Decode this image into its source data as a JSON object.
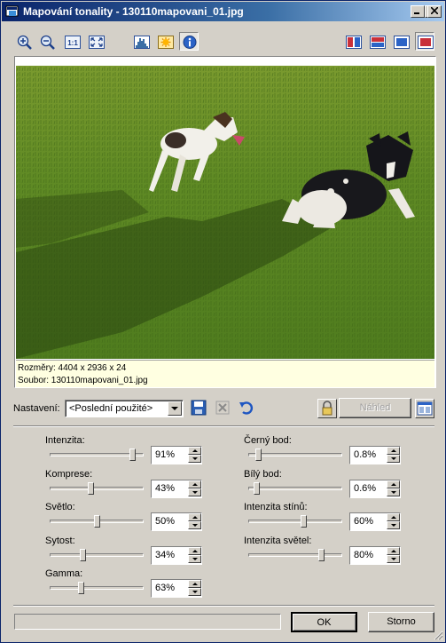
{
  "window": {
    "title": "Mapování tonality - 130110mapovani_01.jpg"
  },
  "toolbar": {
    "left_icons": [
      "zoom-in-icon",
      "zoom-out-icon",
      "actual-size-icon",
      "fit-window-icon",
      "histogram-icon",
      "lighting-icon",
      "info-icon"
    ],
    "right_icons": [
      "split-vertical-icon",
      "split-horizontal-icon",
      "single-view-icon",
      "original-view-icon"
    ]
  },
  "preview": {
    "dimensions": "Rozměry: 4404 x 2936 x 24",
    "file": "Soubor: 130110mapovani_01.jpg"
  },
  "settings": {
    "label": "Nastavení:",
    "selected": "<Poslední použité>",
    "preview_button": "Náhled"
  },
  "sliders_left": [
    {
      "label": "Intenzita:",
      "value": "91%",
      "level": 0.91
    },
    {
      "label": "Komprese:",
      "value": "43%",
      "level": 0.43
    },
    {
      "label": "Světlo:",
      "value": "50%",
      "level": 0.5
    },
    {
      "label": "Sytost:",
      "value": "34%",
      "level": 0.34
    },
    {
      "label": "Gamma:",
      "value": "63%",
      "level": 0.32
    }
  ],
  "sliders_right": [
    {
      "label": "Černý bod:",
      "value": "0.8%",
      "level": 0.08
    },
    {
      "label": "Bílý bod:",
      "value": "0.6%",
      "level": 0.06
    },
    {
      "label": "Intenzita stínů:",
      "value": "60%",
      "level": 0.6
    },
    {
      "label": "Intenzita světel:",
      "value": "80%",
      "level": 0.8
    }
  ],
  "buttons": {
    "ok": "OK",
    "cancel": "Storno"
  }
}
